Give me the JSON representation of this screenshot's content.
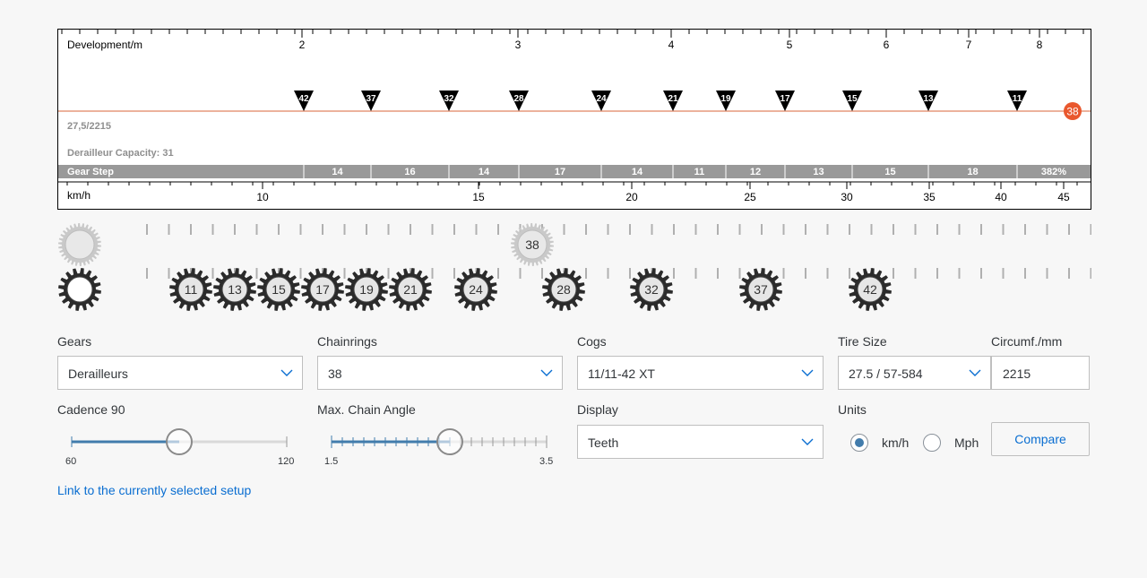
{
  "chart": {
    "dev_label": "Development/m",
    "speed_label": "km/h",
    "info_line1": "27,5/2215",
    "info_line2": "Derailleur Capacity: 31",
    "gear_step_label": "Gear Step",
    "chainring_badge": "38",
    "dev_ticks": [
      "2",
      "3",
      "4",
      "5",
      "6",
      "7",
      "8"
    ],
    "speed_ticks": [
      "10",
      "15",
      "20",
      "25",
      "30",
      "35",
      "40",
      "45"
    ],
    "cog_markers": [
      "42",
      "37",
      "32",
      "28",
      "24",
      "21",
      "19",
      "17",
      "15",
      "13",
      "11"
    ],
    "gear_steps": [
      "14",
      "16",
      "14",
      "17",
      "14",
      "11",
      "12",
      "13",
      "15",
      "18",
      "382%"
    ]
  },
  "gears": {
    "chainring": "38",
    "cogs": [
      "11",
      "13",
      "15",
      "17",
      "19",
      "21",
      "24",
      "28",
      "32",
      "37",
      "42"
    ]
  },
  "form": {
    "gears_label": "Gears",
    "gears_value": "Derailleurs",
    "chainrings_label": "Chainrings",
    "chainrings_value": "38",
    "cogs_label": "Cogs",
    "cogs_value": "11/11-42 XT",
    "tire_label": "Tire Size",
    "tire_value": "27.5 / 57-584",
    "circ_label": "Circumf./mm",
    "circ_value": "2215",
    "cadence_label": "Cadence 90",
    "cadence_min": "60",
    "cadence_max": "120",
    "cadence_value": 90,
    "chain_label": "Max. Chain Angle",
    "chain_min": "1.5",
    "chain_max": "3.5",
    "chain_value": 2.6,
    "display_label": "Display",
    "display_value": "Teeth",
    "units_label": "Units",
    "unit_kmh": "km/h",
    "unit_mph": "Mph",
    "compare_label": "Compare",
    "link_text": "Link to the currently selected setup"
  },
  "colors": {
    "accent": "#0a6ed1",
    "badge": "#e9582e",
    "slider": "#427cac",
    "gearstep": "#999999"
  }
}
